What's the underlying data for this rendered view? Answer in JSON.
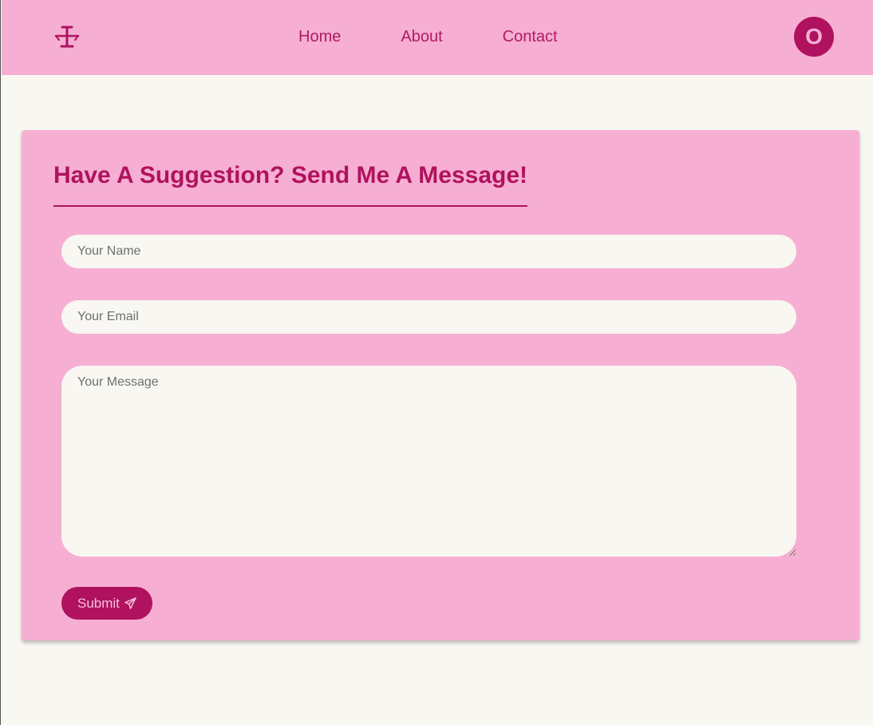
{
  "nav": {
    "logo_icon": "scales-logo-icon",
    "links": [
      {
        "label": "Home"
      },
      {
        "label": "About"
      },
      {
        "label": "Contact"
      }
    ],
    "avatar_letter": "O"
  },
  "form": {
    "title": "Have A Suggestion? Send Me A Message!",
    "name_placeholder": "Your Name",
    "name_value": "",
    "email_placeholder": "Your Email",
    "email_value": "",
    "message_placeholder": "Your Message",
    "message_value": "",
    "submit_label": "Submit",
    "submit_icon": "paper-plane-icon"
  },
  "colors": {
    "accent": "#b0125f",
    "pink": "#f6afd2",
    "background": "#f8f7f2"
  }
}
